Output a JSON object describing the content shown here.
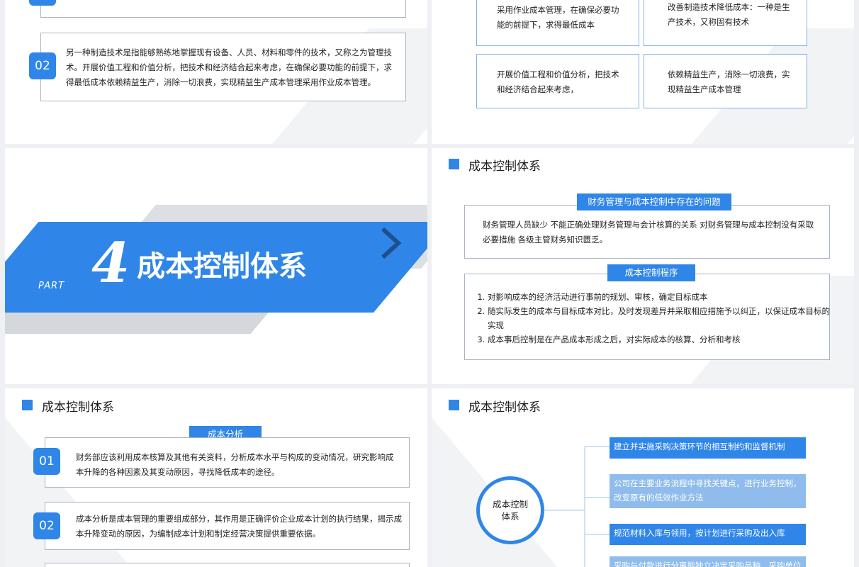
{
  "slide1": {
    "item02_num": "02",
    "item02_text": "另一种制造技术是指能够熟练地掌握现有设备、人员、材料和零件的技术，又称之为管理技术。开展价值工程和价值分析，把技术和经济结合起来考虑，在确保必要功能的前提下，求得最低成本依赖精益生产，消除一切浪费，实现精益生产成本管理采用作业成本管理。"
  },
  "slide2": {
    "cells": [
      "采用作业成本管理，在确保必要功能的前提下，求得最低成本",
      "改善制造技术降低成本：一种是生产技术，又称固有技术",
      "开展价值工程和价值分析，把技术和经济结合起来考虑，",
      "依赖精益生产，消除一切浪费，实现精益生产成本管理"
    ]
  },
  "slide3": {
    "number": "4",
    "part_label": "PART",
    "title": "成本控制体系",
    "chevron": "chevron-right-icon",
    "accent_color": "#2f86e8"
  },
  "slide4": {
    "header": "成本控制体系",
    "tag1": "财务管理与成本控制中存在的问题",
    "box1_text": "财务管理人员缺少  不能正确处理财务管理与会计核算的关系  对财务管理与成本控制没有采取必要措施   各级主管财务知识匮乏。",
    "tag2": "成本控制程序",
    "steps": [
      "对影响成本的经济活动进行事前的规划、审核，确定目标成本",
      "随实际发生的成本与目标成本对比，及时发现差异并采取相应措施予以纠正，以保证成本目标的实现",
      "成本事后控制是在产品成本形成之后，对实际成本的核算、分析和考核"
    ]
  },
  "slide5": {
    "header": "成本控制体系",
    "tag": "成本分析",
    "items": [
      {
        "num": "01",
        "text": "财务部应该利用成本核算及其他有关资料，分析成本水平与构成的变动情况，研究影响成本升降的各种因素及其变动原因，寻找降低成本的途径。"
      },
      {
        "num": "02",
        "text": "成本分析是成本管理的重要组成部分，其作用是正确评价企业成本计划的执行结果，揭示成本升降变动的原因，为编制成本计划和制定经营决策提供重要依据。"
      }
    ]
  },
  "slide6": {
    "header": "成本控制体系",
    "circle_label": "成本控制\n体系",
    "flow": [
      "建立并实施采购决策环节的相互制约和监督机制",
      "公司在主要业务流程中寻找关键点，进行业务控制，改变原有的低效作业方法",
      "规范材料入库与领用，按计划进行采购及出入库",
      "采购与付款进行分离能独立决定采购品种、采购单位"
    ]
  }
}
